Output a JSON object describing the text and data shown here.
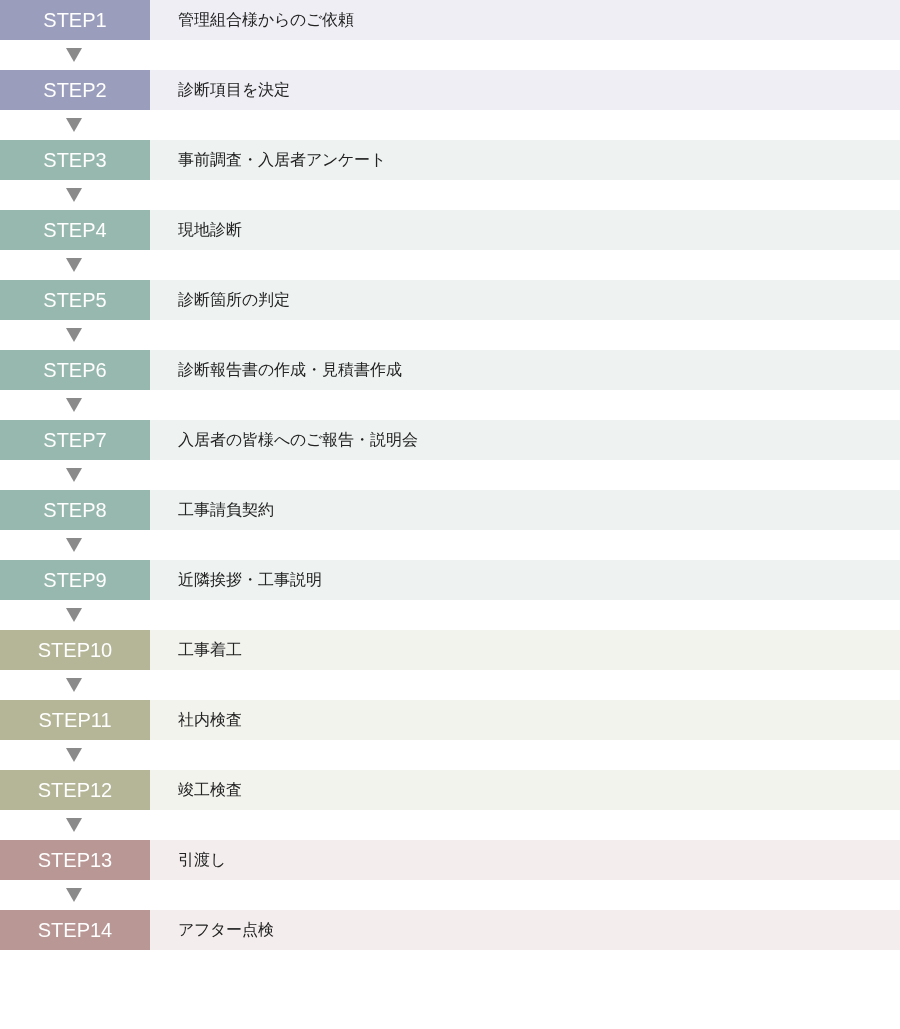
{
  "steps": [
    {
      "label": "STEP1",
      "text": "管理組合様からのご依頼",
      "kind": "request"
    },
    {
      "label": "STEP2",
      "text": "診断項目を決定",
      "kind": "request"
    },
    {
      "label": "STEP3",
      "text": "事前調査・入居者アンケート",
      "kind": "survey"
    },
    {
      "label": "STEP4",
      "text": "現地診断",
      "kind": "survey"
    },
    {
      "label": "STEP5",
      "text": "診断箇所の判定",
      "kind": "survey"
    },
    {
      "label": "STEP6",
      "text": "診断報告書の作成・見積書作成",
      "kind": "survey"
    },
    {
      "label": "STEP7",
      "text": "入居者の皆様へのご報告・説明会",
      "kind": "survey"
    },
    {
      "label": "STEP8",
      "text": "工事請負契約",
      "kind": "survey"
    },
    {
      "label": "STEP9",
      "text": "近隣挨拶・工事説明",
      "kind": "survey"
    },
    {
      "label": "STEP10",
      "text": "工事着工",
      "kind": "construction"
    },
    {
      "label": "STEP11",
      "text": "社内検査",
      "kind": "construction"
    },
    {
      "label": "STEP12",
      "text": "竣工検査",
      "kind": "construction"
    },
    {
      "label": "STEP13",
      "text": "引渡し",
      "kind": "handover"
    },
    {
      "label": "STEP14",
      "text": "アフター点検",
      "kind": "handover"
    }
  ]
}
